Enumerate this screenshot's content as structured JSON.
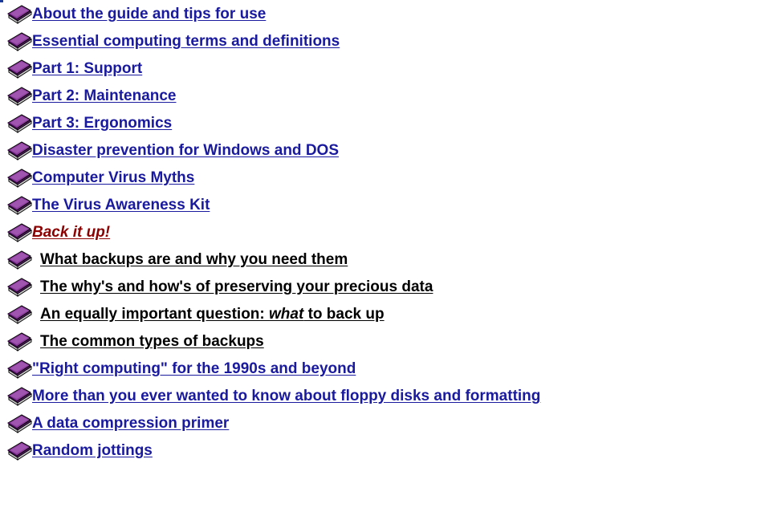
{
  "colors": {
    "link": "#1a1a9e",
    "current": "#8b0000",
    "sub": "#000000",
    "icon_cover": "#7a2a8a",
    "icon_pages": "#e8e8e8"
  },
  "toc": {
    "items": [
      {
        "label": "About the guide and tips for use",
        "icon": "book-icon",
        "style": "blue"
      },
      {
        "label": "Essential computing terms and definitions",
        "icon": "book-icon",
        "style": "blue"
      },
      {
        "label": "Part 1: Support",
        "icon": "book-icon",
        "style": "blue"
      },
      {
        "label": "Part 2: Maintenance",
        "icon": "book-icon",
        "style": "blue"
      },
      {
        "label": "Part 3: Ergonomics",
        "icon": "book-icon",
        "style": "blue"
      },
      {
        "label": "Disaster prevention for Windows and DOS",
        "icon": "book-icon",
        "style": "blue"
      },
      {
        "label": "Computer Virus Myths",
        "icon": "book-icon",
        "style": "blue"
      },
      {
        "label": "The Virus Awareness Kit",
        "icon": "book-icon",
        "style": "blue"
      },
      {
        "label": "Back it up!",
        "icon": "book-icon",
        "style": "current"
      },
      {
        "label": "What backups are and why you need them",
        "icon": "book-icon",
        "style": "sub"
      },
      {
        "label": "The why's and how's of preserving your precious data",
        "icon": "book-icon",
        "style": "sub"
      },
      {
        "label_pre": "An equally important question: ",
        "label_em": "what",
        "label_post": " to back up",
        "icon": "book-icon",
        "style": "sub"
      },
      {
        "label": "The common types of backups",
        "icon": "book-icon",
        "style": "sub"
      },
      {
        "label": "\"Right computing\" for the 1990s and beyond",
        "icon": "book-icon",
        "style": "blue"
      },
      {
        "label": "More than you ever wanted to know about floppy disks and formatting",
        "icon": "book-icon",
        "style": "blue"
      },
      {
        "label": "A data compression primer",
        "icon": "book-icon",
        "style": "blue"
      },
      {
        "label": "Random jottings",
        "icon": "book-icon",
        "style": "blue"
      }
    ]
  }
}
